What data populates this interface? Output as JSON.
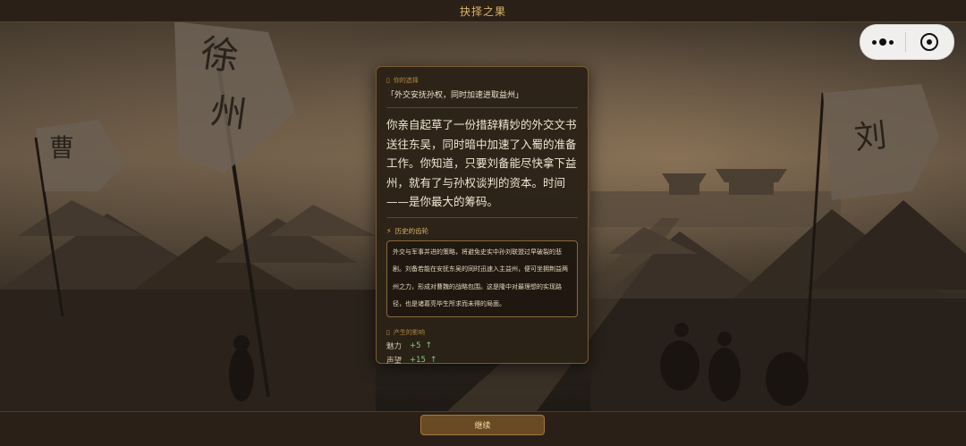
{
  "header": {
    "title": "抉择之果"
  },
  "card": {
    "your_choice_label": "你的选择",
    "choice_text": "「外交安抚孙权，同时加速进取益州」",
    "narrative": "你亲自起草了一份措辞精妙的外交文书送往东吴，同时暗中加速了入蜀的准备工作。你知道，只要刘备能尽快拿下益州，就有了与孙权谈判的资本。时间——是你最大的筹码。",
    "history_label": "历史的齿轮",
    "history_text": "外交与军事并进的策略，将避免史实中孙刘联盟过早破裂的悲剧。刘备若能在安抚东吴的同时迅速入主益州，便可坐拥荆益两州之力，形成对曹魏的战略包围。这是隆中对最理想的实现路径，也是诸葛亮毕生所求而未得的局面。",
    "effects_label": "产生的影响",
    "effects": [
      {
        "name": "魅力",
        "value": "+5",
        "arrow": "↑"
      },
      {
        "name": "声望",
        "value": "+15",
        "arrow": "↑"
      }
    ]
  },
  "scene": {
    "banners": [
      "徐",
      "州",
      "曹",
      "刘"
    ]
  },
  "footer": {
    "continue_label": "继续"
  },
  "colors": {
    "accent": "#d9b36a",
    "positive": "#7fd07a",
    "panel": "#2b2117"
  },
  "icons": {
    "more": "more-dots-icon",
    "close": "close-circle-icon",
    "bolt": "lightning-icon",
    "arrow": "arrow-up-icon"
  }
}
